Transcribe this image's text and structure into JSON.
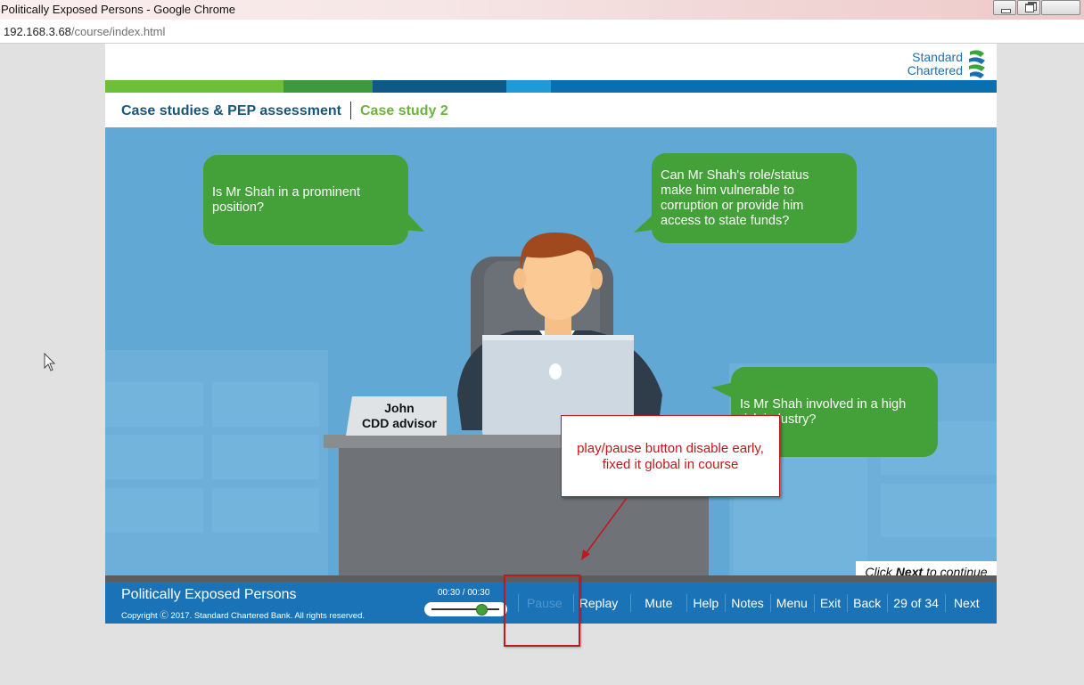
{
  "browser": {
    "window_title": "Politically Exposed Persons - Google Chrome",
    "url_host": "192.168.3.68",
    "url_path": "/course/index.html"
  },
  "course": {
    "logo_line1": "Standard",
    "logo_line2": "Chartered",
    "header": {
      "section": "Case studies & PEP assessment",
      "subsection": "Case study 2"
    },
    "colors": {
      "header_text": "#19577a",
      "sub_text": "#6cb43f",
      "bubble": "#44a038",
      "scene_bg": "#62a8d4",
      "footer_bg": "#1a73b6",
      "bar_segments": [
        "#6cbf3a",
        "#3c9a3c",
        "#0e5988",
        "#1f9ad6",
        "#0a6fae"
      ]
    },
    "scene": {
      "bubbles": [
        {
          "text": "Is Mr Shah in a prominent\nposition?"
        },
        {
          "text": "Can Mr Shah's role/status\nmake him vulnerable to\ncorruption or provide him\naccess to state funds?"
        },
        {
          "text": "Is Mr Shah involved in a high\nrisk industry?"
        }
      ],
      "nameplate_line1": "John",
      "nameplate_line2": "CDD advisor"
    },
    "continue_prompt": {
      "prefix": "Click",
      "bold": "Next",
      "suffix": "to continue"
    },
    "footer": {
      "course_title": "Politically Exposed Persons",
      "copyright": "Copyright Ⓒ 2017. Standard Chartered Bank. All rights reserved.",
      "time": "00:30 / 00:30",
      "progress": 0.74,
      "nav": {
        "pause": "Pause",
        "replay": "Replay",
        "mute": "Mute",
        "help": "Help",
        "notes": "Notes",
        "menu": "Menu",
        "exit": "Exit",
        "back": "Back",
        "page_counter": "29 of 34",
        "next": "Next"
      }
    }
  },
  "annotation": {
    "callout_text": "play/pause button disable early,\nfixed it global in course",
    "color": "#c2171c"
  }
}
